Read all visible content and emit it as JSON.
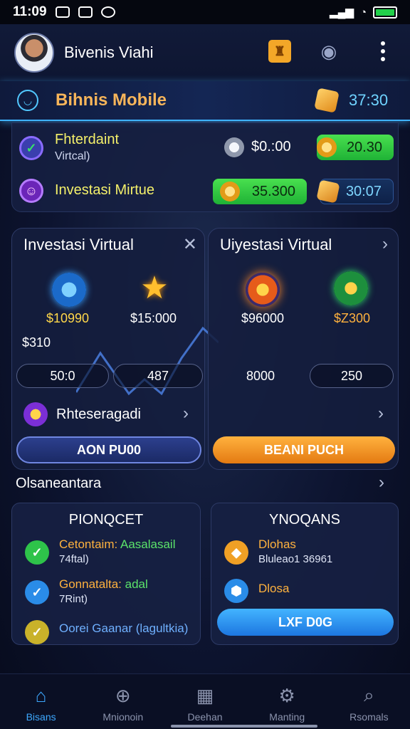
{
  "status_bar": {
    "time": "11:09",
    "icons": [
      "message-icon",
      "sim-icon",
      "sync-icon",
      "wifi-icon",
      "battery-icon"
    ]
  },
  "header": {
    "title": "Bivenis Viahi"
  },
  "brand": {
    "title": "Bihnis Mobile",
    "value": "37:30"
  },
  "wallet": {
    "row1": {
      "title": "Fhterdaint",
      "subtitle": "Virtcal)",
      "silver_value": "$0.:00",
      "green_value": "20.30"
    },
    "row2": {
      "title": "Investasi Mirtue",
      "green_value": "35.300",
      "blue_value": "30:07"
    }
  },
  "invest": {
    "left_panel": {
      "title": "Investasi Virtual",
      "items": [
        {
          "value": "$10990"
        },
        {
          "value": "$15:000"
        }
      ],
      "side_value": "$310",
      "fields": [
        "50:0",
        "487"
      ],
      "link_label": "Rhteseragadi",
      "button_label": "AON PU00"
    },
    "right_panel": {
      "title": "Uiyestasi Virtual",
      "items": [
        {
          "value": "$96000"
        },
        {
          "value": "$Z300"
        }
      ],
      "fields": [
        "8000",
        "250"
      ],
      "button_label": "BEANI PUCH"
    }
  },
  "section": {
    "title": "Olsaneantara"
  },
  "cards": {
    "left": {
      "title": "PIONQCET",
      "items": [
        {
          "text1": "Cetontaim:",
          "text1b": "Aasalasail",
          "text2": "74ftal)"
        },
        {
          "text1": "Gonnatalta:",
          "text1b": "adal",
          "text2": "7Rint)"
        },
        {
          "text1": "Oorei Gaanar (lagultkia)",
          "text1b": "",
          "text2": ""
        }
      ]
    },
    "right": {
      "title": "YNOQANS",
      "items": [
        {
          "text1": "Dlohas",
          "text2": "Bluleao1 36961"
        },
        {
          "text1": "Dlosa",
          "text2": ""
        }
      ],
      "button_label": "LXF D0G"
    }
  },
  "bottom_nav": [
    {
      "label": "Bisans",
      "icon": "home-icon",
      "active": true
    },
    {
      "label": "Mnionoin",
      "icon": "download-icon",
      "active": false
    },
    {
      "label": "Deehan",
      "icon": "chart-icon",
      "active": false
    },
    {
      "label": "Manting",
      "icon": "settings-icon",
      "active": false
    },
    {
      "label": "Rsomals",
      "icon": "search-icon",
      "active": false
    }
  ],
  "colors": {
    "accent_blue": "#3da8ff",
    "accent_orange": "#f7b55a",
    "success_green": "#22d04a"
  }
}
